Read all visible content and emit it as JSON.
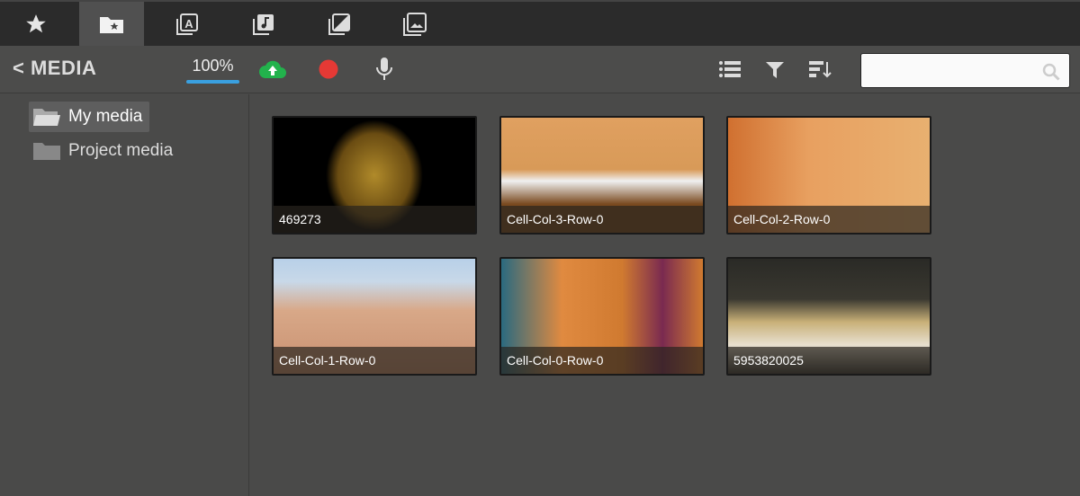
{
  "tabs": [
    {
      "icon": "star-icon"
    },
    {
      "icon": "folder-star-icon",
      "active": true
    },
    {
      "icon": "text-library-icon"
    },
    {
      "icon": "music-library-icon"
    },
    {
      "icon": "contrast-library-icon"
    },
    {
      "icon": "image-library-icon"
    }
  ],
  "toolbar": {
    "back_label": "MEDIA",
    "zoom": "100%",
    "upload_color": "#22b24c",
    "record_color": "#e53935",
    "accent": "#3aa0e0"
  },
  "search": {
    "placeholder": "",
    "value": ""
  },
  "sidebar": {
    "items": [
      {
        "label": "My media",
        "selected": true
      },
      {
        "label": "Project media"
      }
    ]
  },
  "media": [
    {
      "label": "469273"
    },
    {
      "label": "Cell-Col-3-Row-0"
    },
    {
      "label": "Cell-Col-2-Row-0"
    },
    {
      "label": "Cell-Col-1-Row-0"
    },
    {
      "label": "Cell-Col-0-Row-0"
    },
    {
      "label": "5953820025"
    }
  ]
}
